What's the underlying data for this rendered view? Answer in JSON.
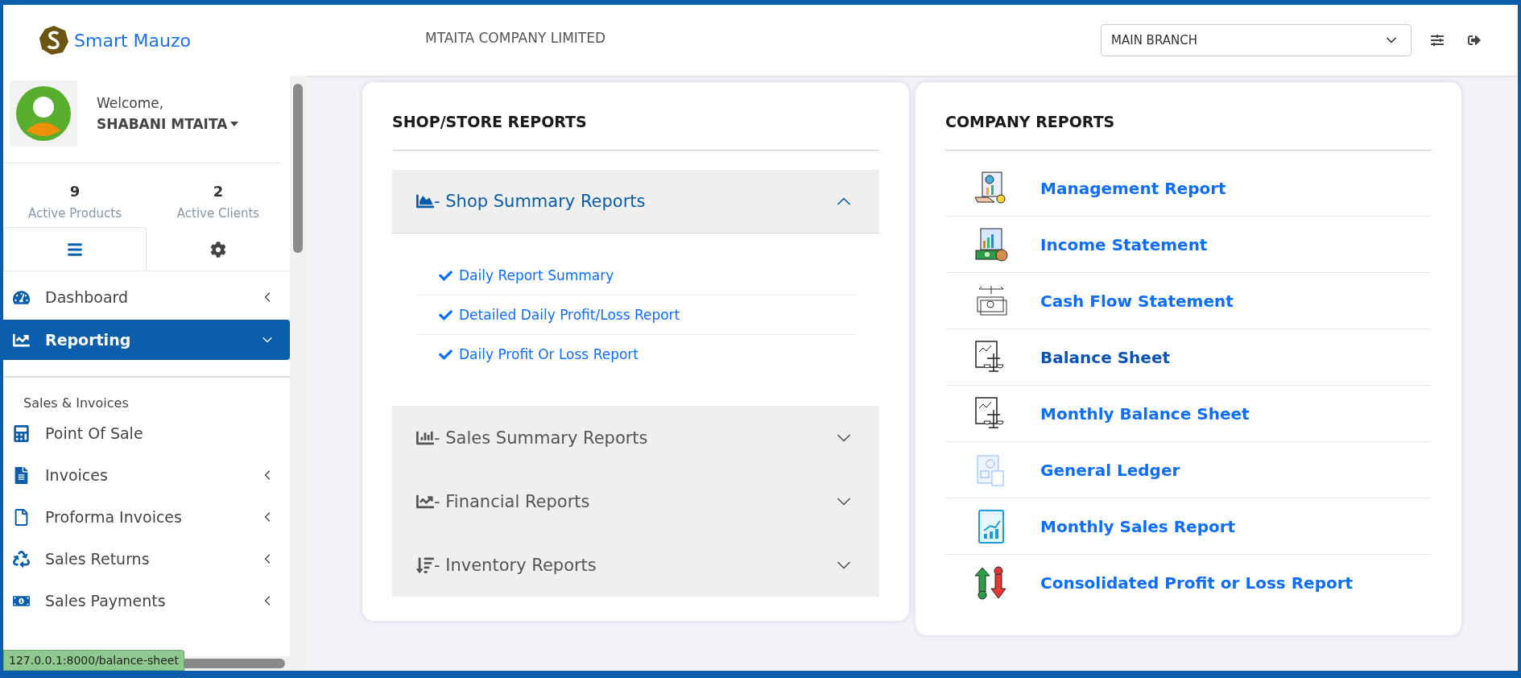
{
  "header": {
    "brand": "Smart Mauzo",
    "company": "MTAITA COMPANY LIMITED",
    "branch_select": {
      "value": "MAIN BRANCH"
    }
  },
  "sidebar": {
    "user": {
      "greeting": "Welcome,",
      "name": "SHABANI MTAITA"
    },
    "stats": [
      {
        "value": "9",
        "label": "Active Products"
      },
      {
        "value": "2",
        "label": "Active Clients"
      }
    ],
    "tabs": [
      {
        "kind": "menu",
        "selected": true
      },
      {
        "kind": "settings",
        "selected": false
      }
    ],
    "items": [
      {
        "kind": "dashboard",
        "label": "Dashboard",
        "selected": false,
        "expandable": true
      },
      {
        "kind": "reporting",
        "label": "Reporting",
        "selected": true,
        "expandable": true
      }
    ],
    "section": "Sales & Invoices",
    "section_items": [
      {
        "kind": "pos",
        "label": "Point Of Sale",
        "selected": false,
        "expandable": false
      },
      {
        "kind": "invoice",
        "label": "Invoices",
        "selected": false,
        "expandable": true
      },
      {
        "kind": "proforma",
        "label": "Proforma Invoices",
        "selected": false,
        "expandable": true
      },
      {
        "kind": "returns",
        "label": "Sales Returns",
        "selected": false,
        "expandable": true
      },
      {
        "kind": "payments",
        "label": "Sales Payments",
        "selected": false,
        "expandable": true
      }
    ]
  },
  "shop_reports": {
    "title": "SHOP/STORE REPORTS",
    "sections": [
      {
        "kind": "area",
        "label": "- Shop Summary Reports",
        "expanded": true,
        "links": [
          "Daily Report Summary",
          "Detailed Daily Profit/Loss Report",
          "Daily Profit Or Loss Report"
        ]
      },
      {
        "kind": "bar",
        "label": "- Sales Summary Reports",
        "expanded": false
      },
      {
        "kind": "line",
        "label": "- Financial Reports",
        "expanded": false
      },
      {
        "kind": "sort",
        "label": "- Inventory Reports",
        "expanded": false
      }
    ]
  },
  "company_reports": {
    "title": "COMPANY REPORTS",
    "items": [
      {
        "kind": "management",
        "label": "Management Report",
        "hovered": false
      },
      {
        "kind": "income",
        "label": "Income Statement",
        "hovered": false
      },
      {
        "kind": "cashflow",
        "label": "Cash Flow Statement",
        "hovered": false
      },
      {
        "kind": "balance",
        "label": "Balance Sheet",
        "hovered": true
      },
      {
        "kind": "balance",
        "label": "Monthly Balance Sheet",
        "hovered": false
      },
      {
        "kind": "ledger",
        "label": "General Ledger",
        "hovered": false
      },
      {
        "kind": "sales",
        "label": "Monthly Sales Report",
        "hovered": false
      },
      {
        "kind": "profitloss",
        "label": "Consolidated Profit or Loss Report",
        "hovered": false
      }
    ]
  },
  "status_url": "127.0.0.1:8000/balance-sheet"
}
